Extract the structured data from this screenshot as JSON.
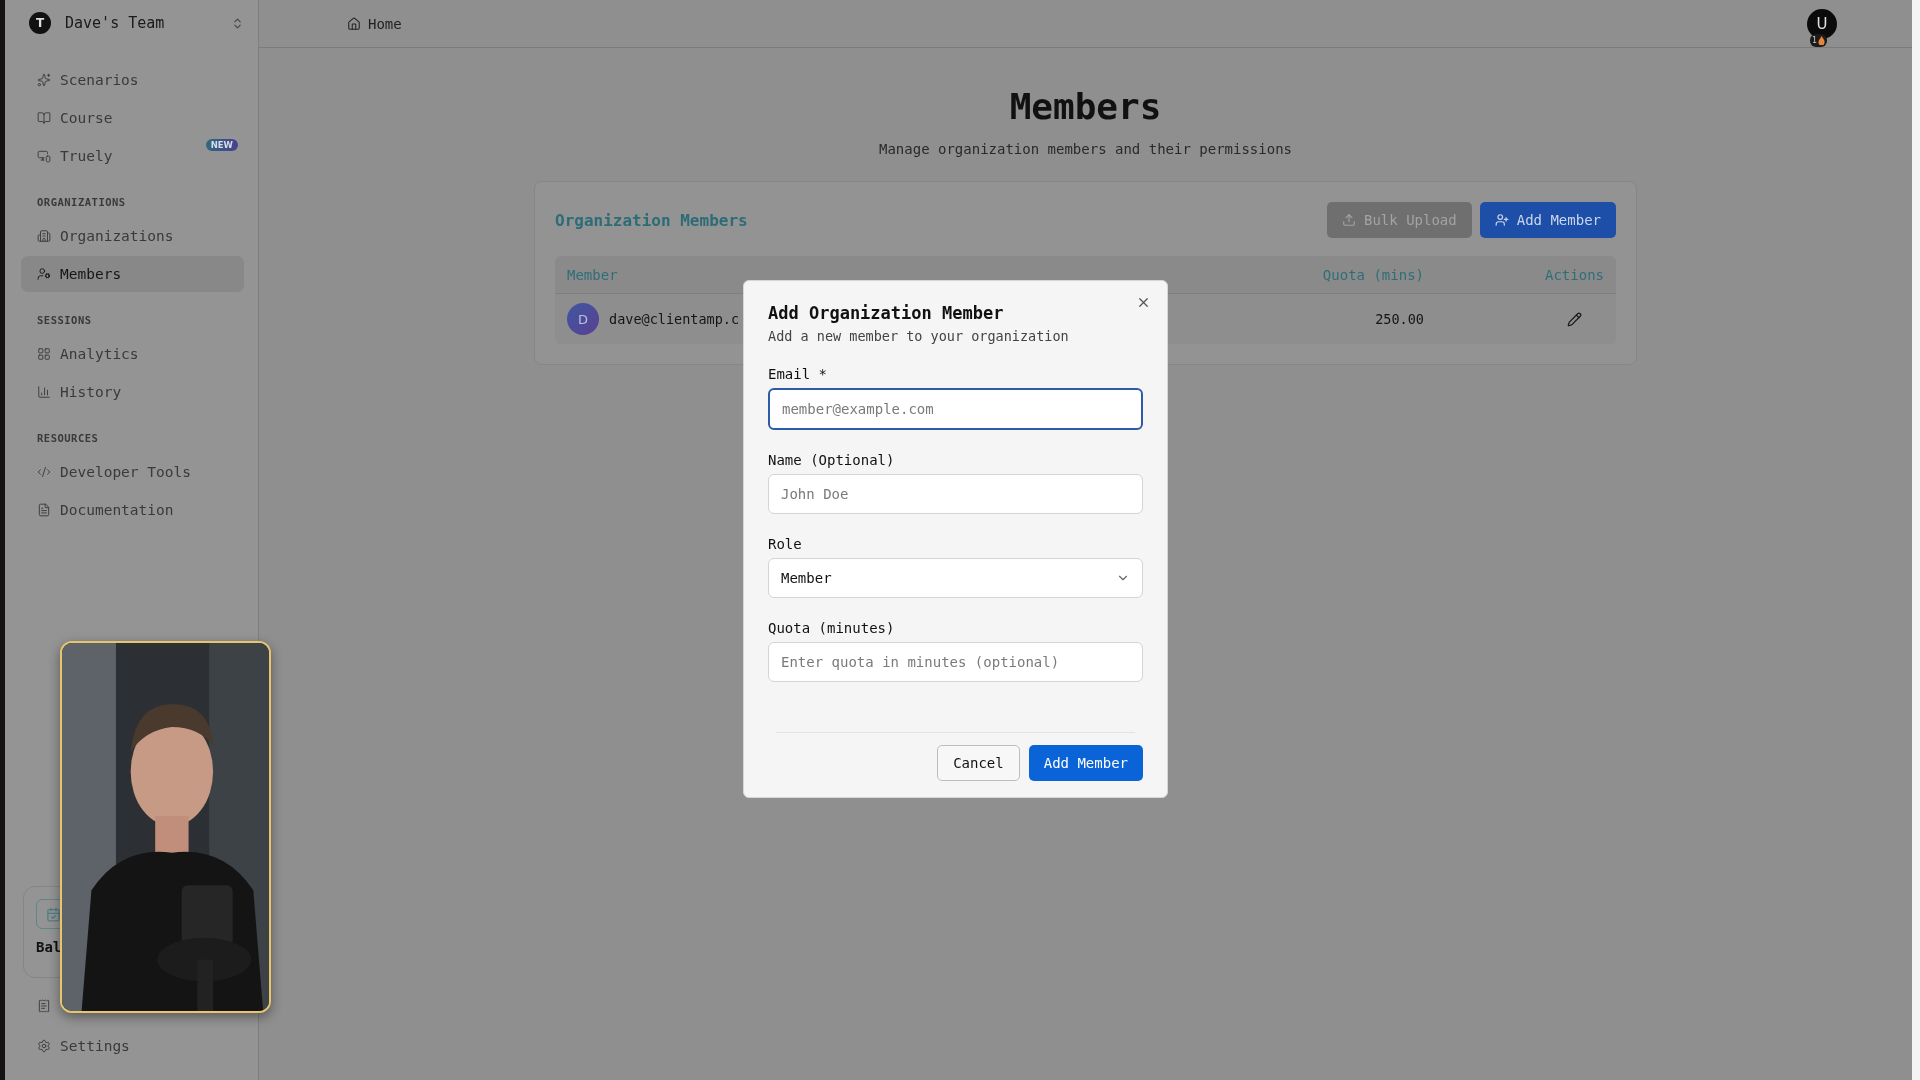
{
  "team": {
    "avatar": "T",
    "name": "Dave's Team"
  },
  "sidebar": {
    "sections": [
      {
        "items": [
          {
            "label": "Scenarios",
            "selected": false
          },
          {
            "label": "Course",
            "selected": false
          },
          {
            "label": "Truely",
            "selected": false,
            "badge": "NEW"
          }
        ]
      },
      {
        "heading": "ORGANIZATIONS",
        "items": [
          {
            "label": "Organizations",
            "selected": false
          },
          {
            "label": "Members",
            "selected": true
          }
        ]
      },
      {
        "heading": "SESSIONS",
        "items": [
          {
            "label": "Analytics",
            "selected": false
          },
          {
            "label": "History",
            "selected": false
          }
        ]
      },
      {
        "heading": "RESOURCES",
        "items": [
          {
            "label": "Developer Tools",
            "selected": false
          },
          {
            "label": "Documentation",
            "selected": false
          }
        ]
      }
    ],
    "balance_card": {
      "title": "Bal"
    },
    "footer_items": [
      {
        "selected": false
      },
      {
        "label": "Settings",
        "selected": false
      }
    ]
  },
  "breadcrumb": "Home",
  "user": {
    "avatar": "U",
    "badge": "1"
  },
  "page": {
    "title": "Members",
    "subtitle": "Manage organization members and their permissions"
  },
  "members_card": {
    "title": "Organization Members",
    "buttons": [
      {
        "label": "Bulk Upload",
        "disabled": true
      },
      {
        "label": "Add Member",
        "disabled": false
      }
    ],
    "columns": [
      "Member",
      "Quota (mins)",
      "Actions"
    ],
    "rows": [
      {
        "avatar": "D",
        "email": "dave@clientamp.c",
        "quota": "250.00"
      }
    ]
  },
  "dialog": {
    "title": "Add Organization Member",
    "description": "Add a new member to your organization",
    "fields": [
      {
        "kind": "text",
        "label": "Email *",
        "placeholder": "member@example.com",
        "focused": true
      },
      {
        "kind": "text",
        "label": "Name (Optional)",
        "placeholder": "John Doe",
        "focused": false
      },
      {
        "kind": "select",
        "label": "Role",
        "value": "Member",
        "focused": false
      },
      {
        "kind": "text",
        "label": "Quota (minutes)",
        "placeholder": "Enter quota in minutes (optional)",
        "focused": false
      }
    ],
    "buttons": [
      {
        "label": "Cancel",
        "primary": false
      },
      {
        "label": "Add Member",
        "primary": true
      }
    ]
  }
}
